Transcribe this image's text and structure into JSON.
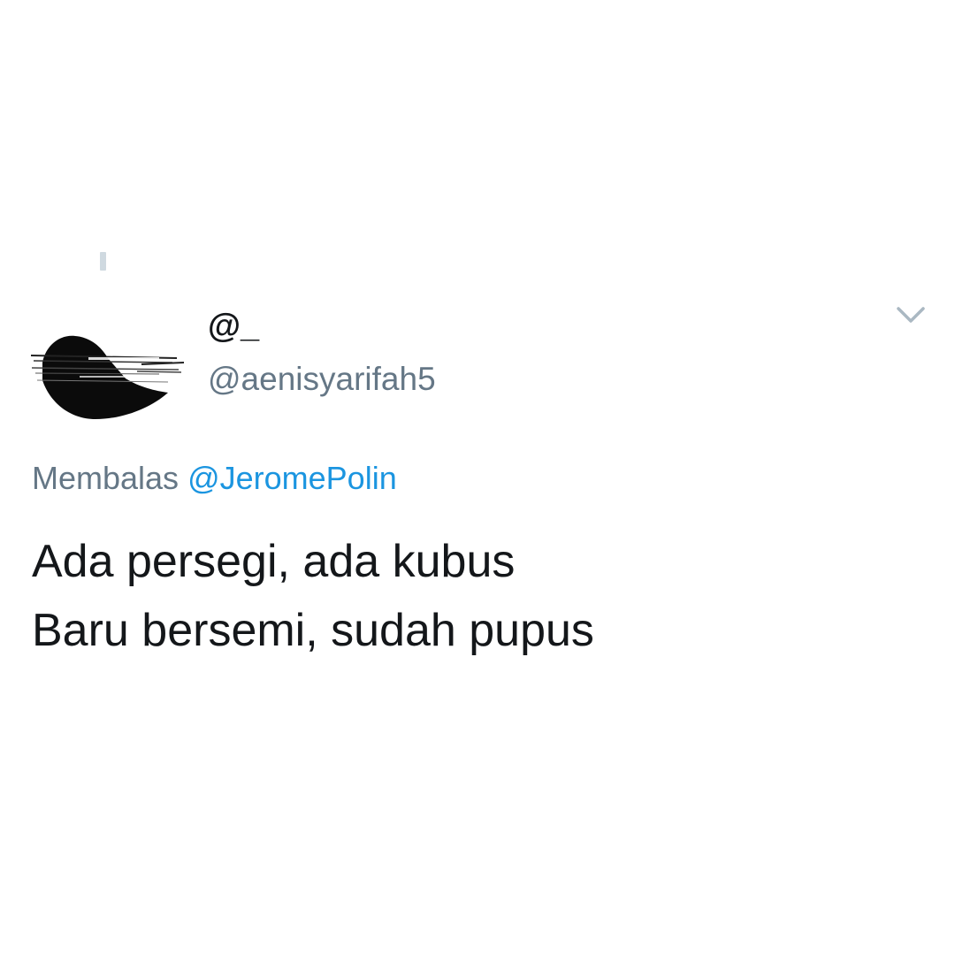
{
  "tweet": {
    "display_name": "@_",
    "handle": "@aenisyarifah5",
    "reply_prefix": "Membalas",
    "reply_mention": "@JeromePolin",
    "text_lines": [
      "Ada persegi, ada kubus",
      "Baru bersemi, sudah pupus"
    ]
  },
  "icons": {
    "menu_caret": "chevron-down-icon",
    "thread": "thread-line",
    "avatar": "avatar"
  },
  "colors": {
    "text_primary": "#14171a",
    "text_secondary": "#657786",
    "link": "#1b95e0",
    "caret": "#aab8c2",
    "thread_line": "#cfd9e0",
    "background": "#ffffff"
  }
}
